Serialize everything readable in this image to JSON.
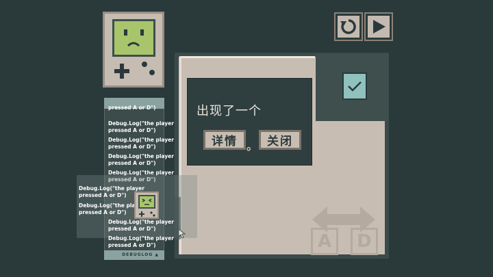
{
  "dialog": {
    "title": "出现了一个",
    "details_button": "详情",
    "separator": "。",
    "close_button": "关闭"
  },
  "keys": {
    "left": "A",
    "right": "D"
  },
  "debug": {
    "header": "pressed A or D\")",
    "lines": [
      [
        "Debug.Log(\"the player",
        "pressed A or D\")"
      ],
      [
        "Debug.Log(\"the player",
        "pressed A or D\")"
      ],
      [
        "Debug.Log(\"the player",
        "pressed A or D\")"
      ],
      [
        "Debug.Log(\"the player",
        "pressed A or D\")"
      ],
      [
        "Debug.Log(\"the player",
        "pressed A or D\")"
      ],
      [
        "Debug.Log(\"the player",
        "pressed A or D\")"
      ],
      [
        "Debug.Log(\"the player",
        "pressed A or D\")"
      ]
    ],
    "footer": "DEBUGLOG ▲",
    "ghost_lines": [
      [
        "Debug.Log(\"the player",
        "pressed A or D\")"
      ],
      [
        "Debug.Log(\"the player",
        "pressed A or D\")"
      ]
    ]
  },
  "colors": {
    "background": "#2a3a3b",
    "panel": "#c8bdb3",
    "screen": "#a8c56b",
    "accent": "#8fc1be"
  },
  "icons": [
    "restart-icon",
    "play-icon",
    "check-icon",
    "dpad-icon",
    "arrow-left-right-icon",
    "mouse-cursor-icon"
  ]
}
